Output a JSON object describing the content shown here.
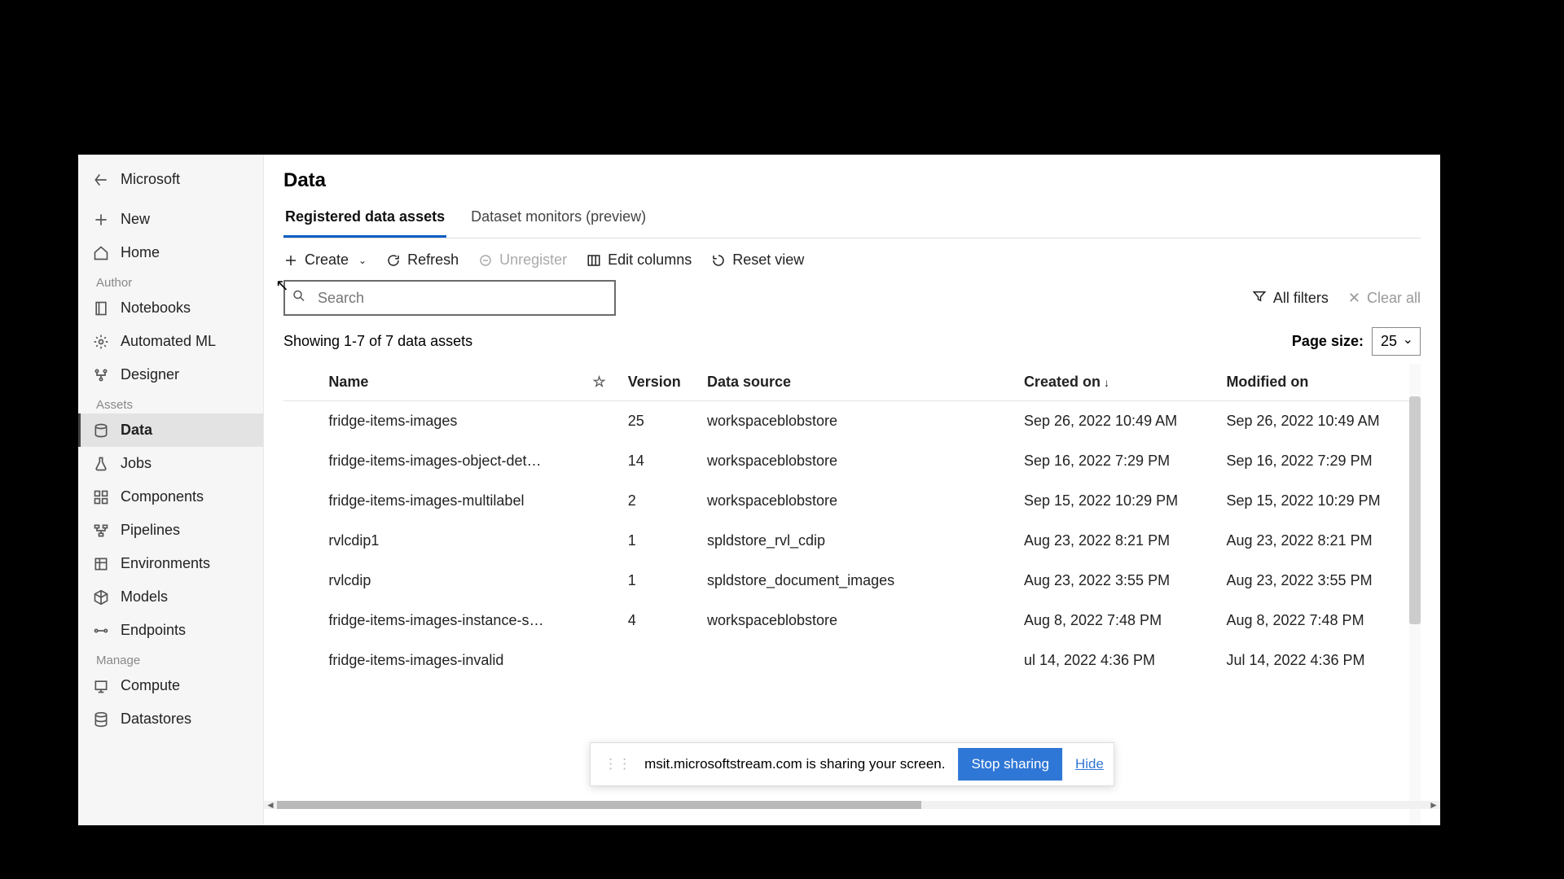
{
  "header": {
    "back_label": "Microsoft"
  },
  "sidebar": {
    "new": "New",
    "home": "Home",
    "group_author": "Author",
    "notebooks": "Notebooks",
    "automl": "Automated ML",
    "designer": "Designer",
    "group_assets": "Assets",
    "data": "Data",
    "jobs": "Jobs",
    "components": "Components",
    "pipelines": "Pipelines",
    "environments": "Environments",
    "models": "Models",
    "endpoints": "Endpoints",
    "group_manage": "Manage",
    "compute": "Compute",
    "datastores": "Datastores"
  },
  "page_title": "Data",
  "tabs": {
    "registered": "Registered data assets",
    "monitors": "Dataset monitors (preview)"
  },
  "toolbar": {
    "create": "Create",
    "refresh": "Refresh",
    "unregister": "Unregister",
    "edit_columns": "Edit columns",
    "reset_view": "Reset view"
  },
  "search_placeholder": "Search",
  "filters": {
    "all": "All filters",
    "clear": "Clear all"
  },
  "showing_text": "Showing 1-7 of 7 data assets",
  "page_size_label": "Page size:",
  "page_size_value": "25",
  "columns": {
    "name": "Name",
    "version": "Version",
    "source": "Data source",
    "created": "Created on",
    "modified": "Modified on"
  },
  "rows": [
    {
      "name": "fridge-items-images",
      "version": "25",
      "source": "workspaceblobstore",
      "created": "Sep 26, 2022 10:49 AM",
      "modified": "Sep 26, 2022 10:49 AM"
    },
    {
      "name": "fridge-items-images-object-det…",
      "version": "14",
      "source": "workspaceblobstore",
      "created": "Sep 16, 2022 7:29 PM",
      "modified": "Sep 16, 2022 7:29 PM"
    },
    {
      "name": "fridge-items-images-multilabel",
      "version": "2",
      "source": "workspaceblobstore",
      "created": "Sep 15, 2022 10:29 PM",
      "modified": "Sep 15, 2022 10:29 PM"
    },
    {
      "name": "rvlcdip1",
      "version": "1",
      "source": "spldstore_rvl_cdip",
      "created": "Aug 23, 2022 8:21 PM",
      "modified": "Aug 23, 2022 8:21 PM"
    },
    {
      "name": "rvlcdip",
      "version": "1",
      "source": "spldstore_document_images",
      "created": "Aug 23, 2022 3:55 PM",
      "modified": "Aug 23, 2022 3:55 PM"
    },
    {
      "name": "fridge-items-images-instance-s…",
      "version": "4",
      "source": "workspaceblobstore",
      "created": "Aug 8, 2022 7:48 PM",
      "modified": "Aug 8, 2022 7:48 PM"
    },
    {
      "name": "fridge-items-images-invalid",
      "version": "",
      "source": "",
      "created": "ul 14, 2022 4:36 PM",
      "modified": "Jul 14, 2022 4:36 PM"
    }
  ],
  "share_bar": {
    "message": "msit.microsoftstream.com is sharing your screen.",
    "stop": "Stop sharing",
    "hide": "Hide"
  }
}
